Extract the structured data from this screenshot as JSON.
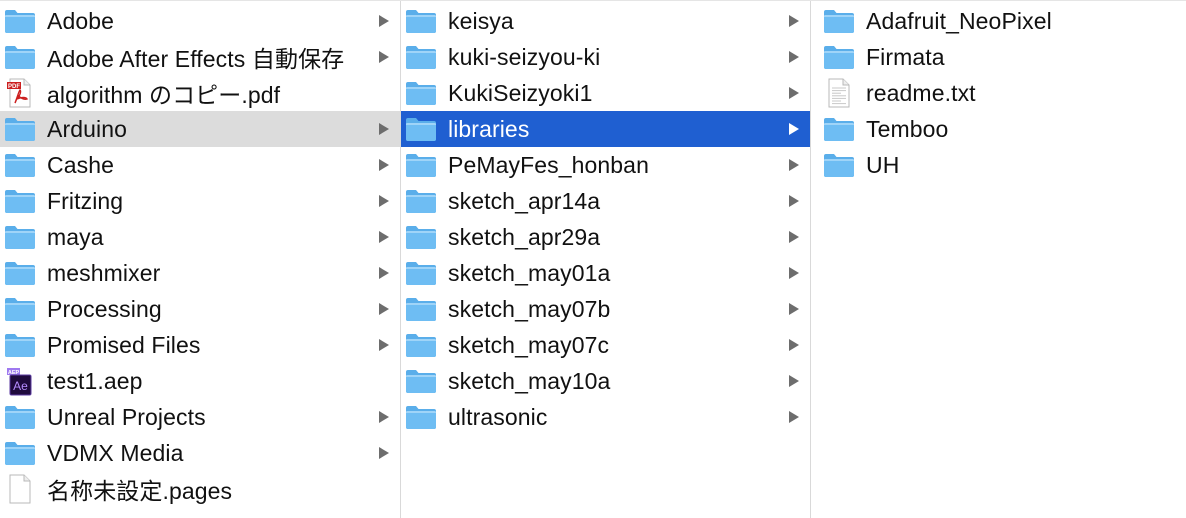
{
  "colors": {
    "folder_body": "#6ebdf3",
    "folder_tab": "#5aaeea",
    "selection_active": "#1f5fd1",
    "selection_parent": "#dcdcdc",
    "chevron": "#6d6d6d",
    "pdf_red": "#cc1f1f",
    "ae_purple": "#1f0a3d",
    "ae_text": "#b68cff"
  },
  "columns": [
    {
      "items": [
        {
          "label": "Adobe",
          "icon": "folder-icon",
          "chevron": true,
          "state": ""
        },
        {
          "label": "Adobe After Effects 自動保存",
          "icon": "folder-icon",
          "chevron": true,
          "state": ""
        },
        {
          "label": "algorithm のコピー.pdf",
          "icon": "pdf-file-icon",
          "chevron": false,
          "state": ""
        },
        {
          "label": "Arduino",
          "icon": "folder-icon",
          "chevron": true,
          "state": "parent-selected"
        },
        {
          "label": "Cashe",
          "icon": "folder-icon",
          "chevron": true,
          "state": ""
        },
        {
          "label": "Fritzing",
          "icon": "folder-icon",
          "chevron": true,
          "state": ""
        },
        {
          "label": "maya",
          "icon": "folder-icon",
          "chevron": true,
          "state": ""
        },
        {
          "label": "meshmixer",
          "icon": "folder-icon",
          "chevron": true,
          "state": ""
        },
        {
          "label": "Processing",
          "icon": "folder-icon",
          "chevron": true,
          "state": ""
        },
        {
          "label": "Promised Files",
          "icon": "folder-icon",
          "chevron": true,
          "state": ""
        },
        {
          "label": "test1.aep",
          "icon": "after-effects-file-icon",
          "chevron": false,
          "state": ""
        },
        {
          "label": "Unreal Projects",
          "icon": "folder-icon",
          "chevron": true,
          "state": ""
        },
        {
          "label": "VDMX Media",
          "icon": "folder-icon",
          "chevron": true,
          "state": ""
        },
        {
          "label": "名称未設定.pages",
          "icon": "document-icon",
          "chevron": false,
          "state": ""
        }
      ]
    },
    {
      "items": [
        {
          "label": "keisya",
          "icon": "folder-icon",
          "chevron": true,
          "state": ""
        },
        {
          "label": "kuki-seizyou-ki",
          "icon": "folder-icon",
          "chevron": true,
          "state": ""
        },
        {
          "label": "KukiSeizyoki1",
          "icon": "folder-icon",
          "chevron": true,
          "state": ""
        },
        {
          "label": "libraries",
          "icon": "folder-icon",
          "chevron": true,
          "state": "active-selected"
        },
        {
          "label": "PeMayFes_honban",
          "icon": "folder-icon",
          "chevron": true,
          "state": ""
        },
        {
          "label": "sketch_apr14a",
          "icon": "folder-icon",
          "chevron": true,
          "state": ""
        },
        {
          "label": "sketch_apr29a",
          "icon": "folder-icon",
          "chevron": true,
          "state": ""
        },
        {
          "label": "sketch_may01a",
          "icon": "folder-icon",
          "chevron": true,
          "state": ""
        },
        {
          "label": "sketch_may07b",
          "icon": "folder-icon",
          "chevron": true,
          "state": ""
        },
        {
          "label": "sketch_may07c",
          "icon": "folder-icon",
          "chevron": true,
          "state": ""
        },
        {
          "label": "sketch_may10a",
          "icon": "folder-icon",
          "chevron": true,
          "state": ""
        },
        {
          "label": "ultrasonic",
          "icon": "folder-icon",
          "chevron": true,
          "state": ""
        }
      ]
    },
    {
      "items": [
        {
          "label": "Adafruit_NeoPixel",
          "icon": "folder-icon",
          "chevron": false,
          "state": ""
        },
        {
          "label": "Firmata",
          "icon": "folder-icon",
          "chevron": false,
          "state": ""
        },
        {
          "label": "readme.txt",
          "icon": "text-file-icon",
          "chevron": false,
          "state": ""
        },
        {
          "label": "Temboo",
          "icon": "folder-icon",
          "chevron": false,
          "state": ""
        },
        {
          "label": "UH",
          "icon": "folder-icon",
          "chevron": false,
          "state": ""
        }
      ]
    }
  ],
  "icon_text": {
    "pdf_badge": "PDF",
    "ae_badge": "Ae",
    "ae_tag": "AEP"
  }
}
